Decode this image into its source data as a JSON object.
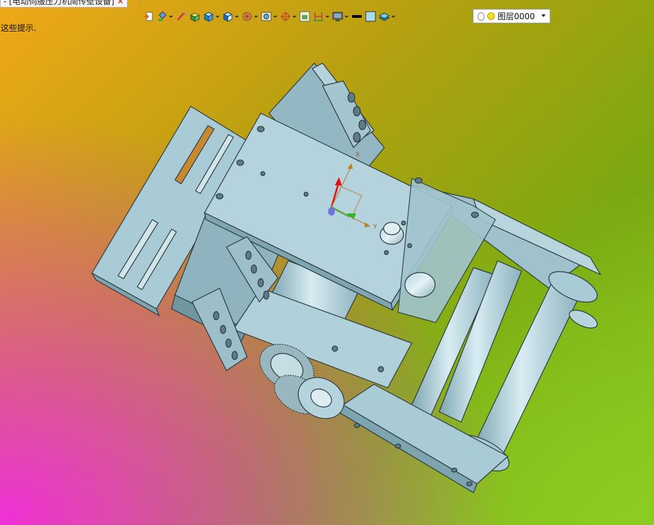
{
  "tab": {
    "title": "- [电动伺服压力机简传壁设备]",
    "close_glyph": "✕"
  },
  "hint": "这些提示.",
  "toolbar": {
    "items": [
      {
        "icon": "import-icon",
        "has_menu": false
      },
      {
        "icon": "paint-bucket-icon",
        "has_menu": true
      },
      {
        "icon": "brush-icon",
        "has_menu": false
      },
      {
        "icon": "solid-box-icon",
        "has_menu": false
      },
      {
        "icon": "cube-icon",
        "has_menu": true
      },
      {
        "icon": "cube-section-icon",
        "has_menu": true
      },
      {
        "icon": "wheel-icon",
        "has_menu": true
      },
      {
        "icon": "frame-view-icon",
        "has_menu": true
      },
      {
        "icon": "axis-icon",
        "has_menu": true
      },
      {
        "icon": "window-icon",
        "has_menu": false
      },
      {
        "icon": "measure-icon",
        "has_menu": true
      },
      {
        "icon": "monitor-icon",
        "has_menu": true
      },
      {
        "icon": "line-style-icon",
        "has_menu": false
      },
      {
        "icon": "color-fill-icon",
        "has_menu": false
      },
      {
        "icon": "layers-icon",
        "has_menu": true
      }
    ],
    "layer": {
      "name": "图层0000"
    }
  },
  "colors": {
    "part": "#a8ccd8",
    "part_dark": "#6f9aa8",
    "edge": "#2a3a40"
  },
  "triad": {
    "label_x": "X",
    "label_y": "Y"
  }
}
